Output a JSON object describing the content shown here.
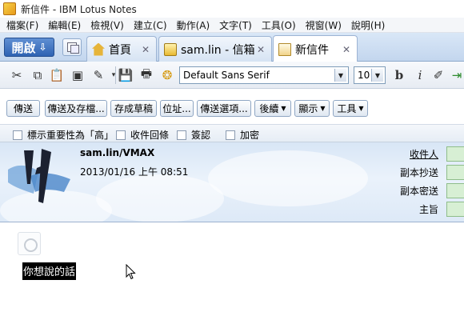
{
  "window": {
    "title": "新信件 - IBM Lotus Notes"
  },
  "menu": [
    "檔案(F)",
    "編輯(E)",
    "檢視(V)",
    "建立(C)",
    "動作(A)",
    "文字(T)",
    "工具(O)",
    "視窗(W)",
    "說明(H)"
  ],
  "tabbar": {
    "open_label": "開啟",
    "tabs": [
      {
        "label": "首頁",
        "icon": "home-icon"
      },
      {
        "label": "sam.lin - 信箱",
        "icon": "inbox-icon"
      },
      {
        "label": "新信件",
        "icon": "new-mail-icon"
      }
    ],
    "close_glyph": "✕"
  },
  "toolbar": {
    "font": "Default Sans Serif",
    "size": "10"
  },
  "actions": [
    "傳送",
    "傳送及存檔...",
    "存成草稿",
    "位址...",
    "傳送選項...",
    "後續",
    "顯示",
    "工具"
  ],
  "options": [
    "標示重要性為「高」",
    "收件回條",
    "簽認",
    "加密"
  ],
  "header": {
    "sender": "sam.lin/VMAX",
    "datetime": "2013/01/16 上午 08:51",
    "fields": [
      "收件人",
      "副本抄送",
      "副本密送",
      "主旨"
    ]
  },
  "body": {
    "text": "你想說的話"
  }
}
